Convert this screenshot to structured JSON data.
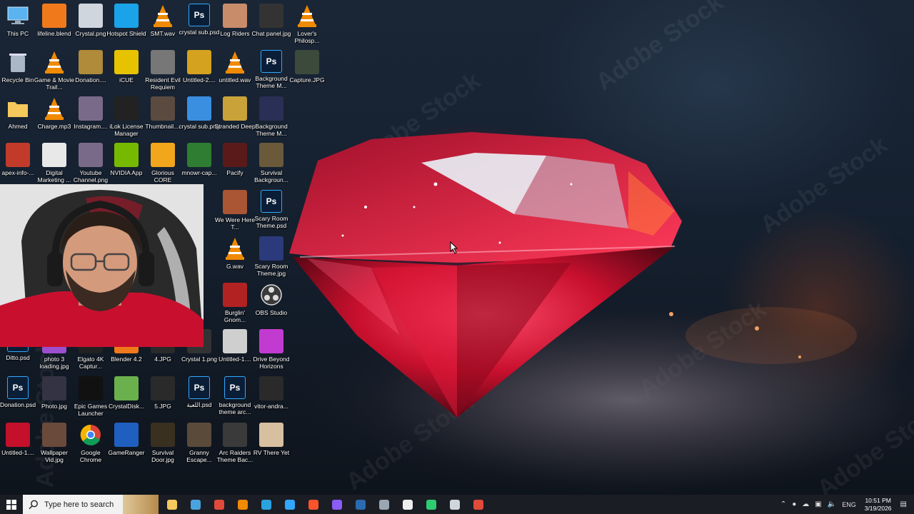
{
  "desktop": {
    "watermark": "Adobe Stock",
    "icons": [
      {
        "label": "This PC",
        "icon": "this-pc-icon",
        "color": "#5bb3f0"
      },
      {
        "label": "lifeline.blend",
        "icon": "blender-file-icon",
        "color": "#f07a1b"
      },
      {
        "label": "Crystal.png",
        "icon": "crystal-image-icon",
        "color": "#cfd6de"
      },
      {
        "label": "Hotspot Shield",
        "icon": "hotspot-shield-icon",
        "color": "#1aa3e8"
      },
      {
        "label": "SMT.wav",
        "icon": "vlc-icon",
        "color": "#f08a00"
      },
      {
        "label": "crystal sub.psd",
        "icon": "photoshop-file-icon",
        "color": "#31a8ff"
      },
      {
        "label": "Log Riders",
        "icon": "game-shortcut-icon",
        "color": "#c98c6a"
      },
      {
        "label": "Chat panel.jpg",
        "icon": "image-file-icon",
        "color": "#333333"
      },
      {
        "label": "Lover's Philosp...",
        "icon": "vlc-icon",
        "color": "#f08a00"
      },
      {
        "label": "Recycle Bin",
        "icon": "recycle-bin-icon",
        "color": "#a9b7c6"
      },
      {
        "label": "Game & Movie Trail...",
        "icon": "vlc-icon",
        "color": "#f08a00"
      },
      {
        "label": "Donation....",
        "icon": "image-file-icon",
        "color": "#b08b3a"
      },
      {
        "label": "iCUE",
        "icon": "icue-icon",
        "color": "#e6c200"
      },
      {
        "label": "Resident Evil Requiem",
        "icon": "game-shortcut-icon",
        "color": "#777777"
      },
      {
        "label": "Untitled-2....",
        "icon": "image-file-icon",
        "color": "#d4a21e"
      },
      {
        "label": "untitled.wav",
        "icon": "vlc-icon",
        "color": "#f08a00"
      },
      {
        "label": "Background Theme M...",
        "icon": "photoshop-file-icon",
        "color": "#31a8ff"
      },
      {
        "label": "Capture.JPG",
        "icon": "image-file-icon",
        "color": "#3c4a3c"
      },
      {
        "label": "Ahmed",
        "icon": "folder-icon",
        "color": "#f4c85a"
      },
      {
        "label": "Charge.mp3",
        "icon": "vlc-icon",
        "color": "#f08a00"
      },
      {
        "label": "Instagram....",
        "icon": "image-file-icon",
        "color": "#7a6a8a"
      },
      {
        "label": "iLok License Manager",
        "icon": "ilok-icon",
        "color": "#222222"
      },
      {
        "label": "Thumbnail....",
        "icon": "image-file-icon",
        "color": "#5a4a40"
      },
      {
        "label": "crystal sub.png",
        "icon": "crystal-image-icon",
        "color": "#3a8fe0"
      },
      {
        "label": "Stranded Deep",
        "icon": "game-shortcut-icon",
        "color": "#c9a23a"
      },
      {
        "label": "Background Theme M...",
        "icon": "image-file-icon",
        "color": "#2a2f55"
      },
      {
        "label": "apex-info-...",
        "icon": "image-file-icon",
        "color": "#c23b2a"
      },
      {
        "label": "Digital Marketing ...",
        "icon": "document-icon",
        "color": "#e8e8e8"
      },
      {
        "label": "Youtube Channel.png",
        "icon": "image-file-icon",
        "color": "#7a6a8a"
      },
      {
        "label": "NVIDIA App",
        "icon": "nvidia-icon",
        "color": "#76b900"
      },
      {
        "label": "Glorious CORE",
        "icon": "glorious-icon",
        "color": "#f2a61c"
      },
      {
        "label": "mnowr-cap...",
        "icon": "image-file-icon",
        "color": "#2e7d32"
      },
      {
        "label": "Pacify",
        "icon": "game-shortcut-icon",
        "color": "#5a1a1a"
      },
      {
        "label": "Survival Backgroun...",
        "icon": "image-file-icon",
        "color": "#6a5a3a"
      },
      {
        "label": "We Were Here T...",
        "icon": "game-shortcut-icon",
        "color": "#aa5533"
      },
      {
        "label": "Scary Room Theme.psd",
        "icon": "photoshop-file-icon",
        "color": "#31a8ff"
      },
      {
        "label": "G.wav",
        "icon": "vlc-icon",
        "color": "#f08a00"
      },
      {
        "label": "Scary Room Theme.jpg",
        "icon": "image-file-icon",
        "color": "#2a3a7a"
      },
      {
        "label": "Burglin' Gnom...",
        "icon": "game-shortcut-icon",
        "color": "#b22222"
      },
      {
        "label": "OBS Studio",
        "icon": "obs-icon",
        "color": "#3a3a3a"
      },
      {
        "label": "Ditto.psd",
        "icon": "photoshop-file-icon",
        "color": "#31a8ff"
      },
      {
        "label": "photo 3 loading.jpg",
        "icon": "image-file-icon",
        "color": "#9b4fcf"
      },
      {
        "label": "Elgato 4K Captur...",
        "icon": "elgato-icon",
        "color": "#222222"
      },
      {
        "label": "Blender 4.2",
        "icon": "blender-icon",
        "color": "#f07a1b"
      },
      {
        "label": "4.JPG",
        "icon": "image-file-icon",
        "color": "#2a2a2a"
      },
      {
        "label": "Crystal 1.png",
        "icon": "image-file-icon",
        "color": "#333333"
      },
      {
        "label": "Untitled-1....",
        "icon": "image-file-icon",
        "color": "#cfcfcf"
      },
      {
        "label": "Drive Beyond Horizons",
        "icon": "game-shortcut-icon",
        "color": "#c23bd0"
      },
      {
        "label": "Donation.psd",
        "icon": "photoshop-file-icon",
        "color": "#31a8ff"
      },
      {
        "label": "Photo.jpg",
        "icon": "image-file-icon",
        "color": "#333344"
      },
      {
        "label": "Epic Games Launcher",
        "icon": "epic-games-icon",
        "color": "#111111"
      },
      {
        "label": "CrystalDisk...",
        "icon": "crystaldisk-icon",
        "color": "#6ab04c"
      },
      {
        "label": "5.JPG",
        "icon": "image-file-icon",
        "color": "#2a2a2a"
      },
      {
        "label": "اللعبة.psd",
        "icon": "photoshop-file-icon",
        "color": "#31a8ff"
      },
      {
        "label": "background theme arc...",
        "icon": "photoshop-file-icon",
        "color": "#31a8ff"
      },
      {
        "label": "vitor-andra...",
        "icon": "image-file-icon",
        "color": "#2a2a2a"
      },
      {
        "label": "Untitled-1....",
        "icon": "image-file-icon",
        "color": "#c4102a"
      },
      {
        "label": "Wallpaper Vid.jpg",
        "icon": "image-file-icon",
        "color": "#6a4a3a"
      },
      {
        "label": "Google Chrome",
        "icon": "chrome-icon",
        "color": "#4285f4"
      },
      {
        "label": "GameRanger",
        "icon": "gameranger-icon",
        "color": "#1f5fbf"
      },
      {
        "label": "Survival Door.jpg",
        "icon": "image-file-icon",
        "color": "#3a3020"
      },
      {
        "label": "Granny Escape...",
        "icon": "game-shortcut-icon",
        "color": "#5a4a3a"
      },
      {
        "label": "Arc Raiders Theme Bac...",
        "icon": "image-file-icon",
        "color": "#3a3a3a"
      },
      {
        "label": "RV There Yet",
        "icon": "game-shortcut-icon",
        "color": "#d7c0a0"
      }
    ]
  },
  "taskbar": {
    "search_placeholder": "Type here to search",
    "apps": [
      {
        "name": "file-explorer",
        "color": "#f4c85a"
      },
      {
        "name": "task-view",
        "color": "#4aa3df"
      },
      {
        "name": "chrome",
        "color": "#e04a3a"
      },
      {
        "name": "vlc",
        "color": "#f08a00"
      },
      {
        "name": "telegram",
        "color": "#2aa3df"
      },
      {
        "name": "photoshop",
        "color": "#31a8ff"
      },
      {
        "name": "brave-like",
        "color": "#fb542b"
      },
      {
        "name": "discord-like",
        "color": "#8a5cf6"
      },
      {
        "name": "steam",
        "color": "#2a6bb0"
      },
      {
        "name": "app-diamond",
        "color": "#9aa6b2"
      },
      {
        "name": "capcut",
        "color": "#eeeeee"
      },
      {
        "name": "app-green",
        "color": "#2ecc71"
      },
      {
        "name": "app-window",
        "color": "#cfd6de"
      },
      {
        "name": "app-red",
        "color": "#e04a3a"
      }
    ],
    "language": "ENG",
    "time": "10:51 PM",
    "date": "3/19/2026"
  }
}
